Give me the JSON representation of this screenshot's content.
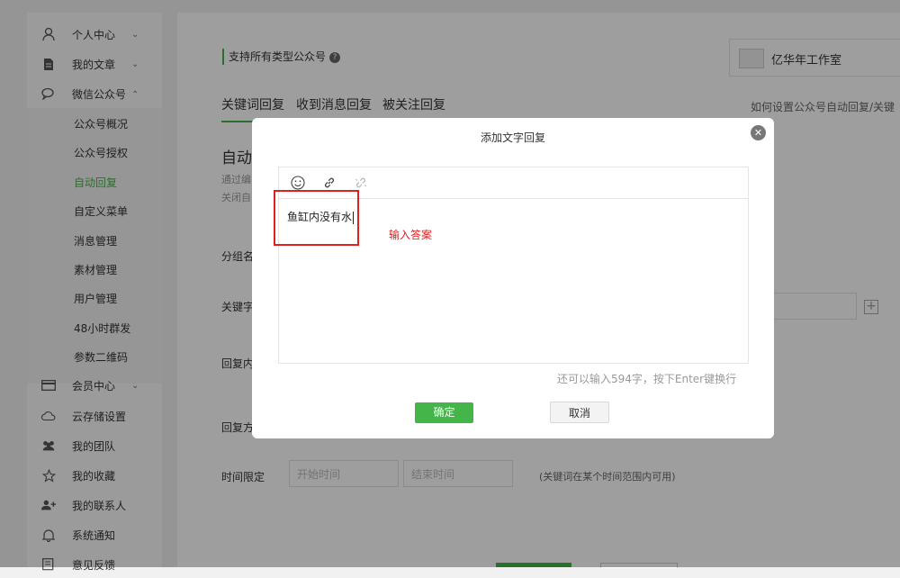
{
  "sidebar": {
    "top_items": [
      {
        "label": "个人中心",
        "icon": "user-icon"
      },
      {
        "label": "我的文章",
        "icon": "document-icon"
      },
      {
        "label": "微信公众号",
        "icon": "chat-bubble-icon"
      }
    ],
    "sub_items": [
      {
        "label": "公众号概况"
      },
      {
        "label": "公众号授权"
      },
      {
        "label": "自动回复"
      },
      {
        "label": "自定义菜单"
      },
      {
        "label": "消息管理"
      },
      {
        "label": "素材管理"
      },
      {
        "label": "用户管理"
      },
      {
        "label": "48小时群发"
      },
      {
        "label": "参数二维码"
      }
    ],
    "bottom_items": [
      {
        "label": "会员中心",
        "icon": "card-icon"
      },
      {
        "label": "云存储设置",
        "icon": "cloud-icon"
      },
      {
        "label": "我的团队",
        "icon": "team-icon"
      },
      {
        "label": "我的收藏",
        "icon": "star-icon"
      },
      {
        "label": "我的联系人",
        "icon": "add-contact-icon"
      },
      {
        "label": "系统通知",
        "icon": "bell-icon"
      },
      {
        "label": "意见反馈",
        "icon": "feedback-icon"
      }
    ]
  },
  "main": {
    "support_text": "支持所有类型公众号",
    "account_name": "亿华年工作室",
    "tabs": [
      {
        "label": "关键词回复"
      },
      {
        "label": "收到消息回复"
      },
      {
        "label": "被关注回复"
      }
    ],
    "how_link": "如何设置公众号自动回复/关键",
    "heading": "自动回",
    "desc1": "通过编",
    "desc2": "关闭自",
    "labels": {
      "group": "分组名",
      "keyword": "关键字",
      "reply_content": "回复内",
      "reply_method": "回复方",
      "time_limit": "时间限定"
    },
    "time_start_placeholder": "开始时间",
    "time_end_placeholder": "结束时间",
    "time_note": "(关键词在某个时间范围内可用)"
  },
  "modal": {
    "title": "添加文字回复",
    "editor_text": "鱼缸内没有水",
    "annotation": "输入答案",
    "counter": "还可以输入594字，按下Enter键换行",
    "ok_label": "确定",
    "cancel_label": "取消"
  },
  "colors": {
    "accent": "#44b549",
    "annotation": "#e02020"
  }
}
